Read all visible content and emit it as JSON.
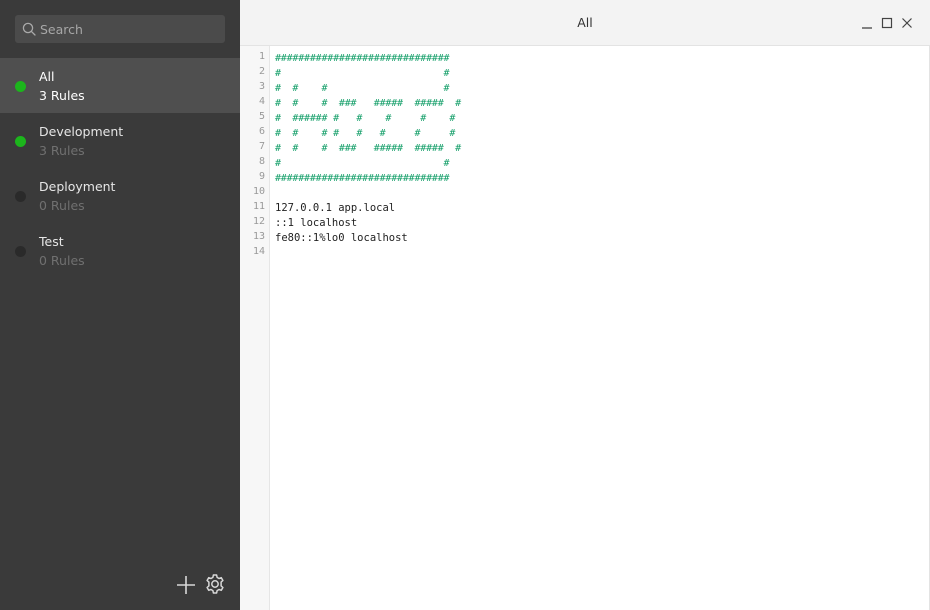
{
  "search": {
    "placeholder": "Search"
  },
  "groups": [
    {
      "name": "All",
      "count": "3 Rules",
      "status_color": "#1cb51c",
      "active": true
    },
    {
      "name": "Development",
      "count": "3 Rules",
      "status_color": "#1cb51c",
      "active": false
    },
    {
      "name": "Deployment",
      "count": "0 Rules",
      "status_color": "#2a2a2a",
      "active": false
    },
    {
      "name": "Test",
      "count": "0 Rules",
      "status_color": "#2a2a2a",
      "active": false
    }
  ],
  "toolbar": {
    "add_icon": "plus-icon",
    "settings_icon": "gear-icon"
  },
  "window": {
    "title": "All"
  },
  "editor": {
    "line_numbers": [
      "1",
      "2",
      "3",
      "4",
      "5",
      "6",
      "7",
      "8",
      "9",
      "10",
      "11",
      "12",
      "13",
      "14"
    ],
    "lines": [
      "##############################",
      "#                            #",
      "#  #    #                    #",
      "#  #    #  ###   #####  #####  #",
      "#  ###### #   #    #     #    #",
      "#  #    # #   #   #     #     #",
      "#  #    #  ###   #####  #####  #",
      "#                            #",
      "##############################",
      "",
      "127.0.0.1 app.local",
      "::1 localhost",
      "fe80::1%lo0 localhost",
      ""
    ],
    "comment_color": "#17a06b"
  }
}
